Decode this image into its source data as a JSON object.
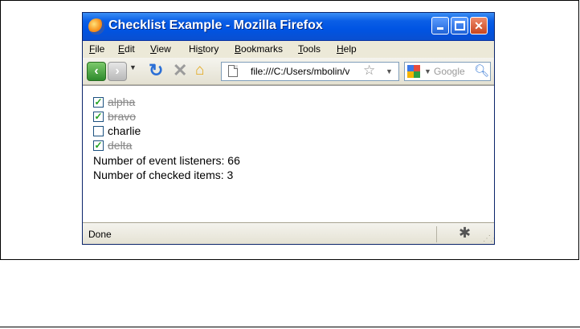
{
  "window": {
    "title": "Checklist Example - Mozilla Firefox"
  },
  "menu": [
    "File",
    "Edit",
    "View",
    "History",
    "Bookmarks",
    "Tools",
    "Help"
  ],
  "menu_accelerators": [
    "F",
    "E",
    "V",
    "s",
    "B",
    "T",
    "H"
  ],
  "toolbar": {
    "url": "file:///C:/Users/mbolin/v",
    "search_placeholder": "Google",
    "icons": [
      "back-icon",
      "forward-icon",
      "reload-icon",
      "stop-icon",
      "home-icon",
      "page-icon",
      "bookmark-star-icon",
      "google-search-engine-icon",
      "search-magnifier-icon"
    ]
  },
  "checklist": [
    {
      "label": "alpha",
      "checked": true
    },
    {
      "label": "bravo",
      "checked": true
    },
    {
      "label": "charlie",
      "checked": false
    },
    {
      "label": "delta",
      "checked": true
    }
  ],
  "info": {
    "listeners": "Number of event listeners: 66",
    "checked": "Number of checked items: 3"
  },
  "status": {
    "text": "Done"
  },
  "colors": {
    "titlebar": "#0054e3",
    "close_button": "#c9461f",
    "check_mark": "#21a121"
  }
}
